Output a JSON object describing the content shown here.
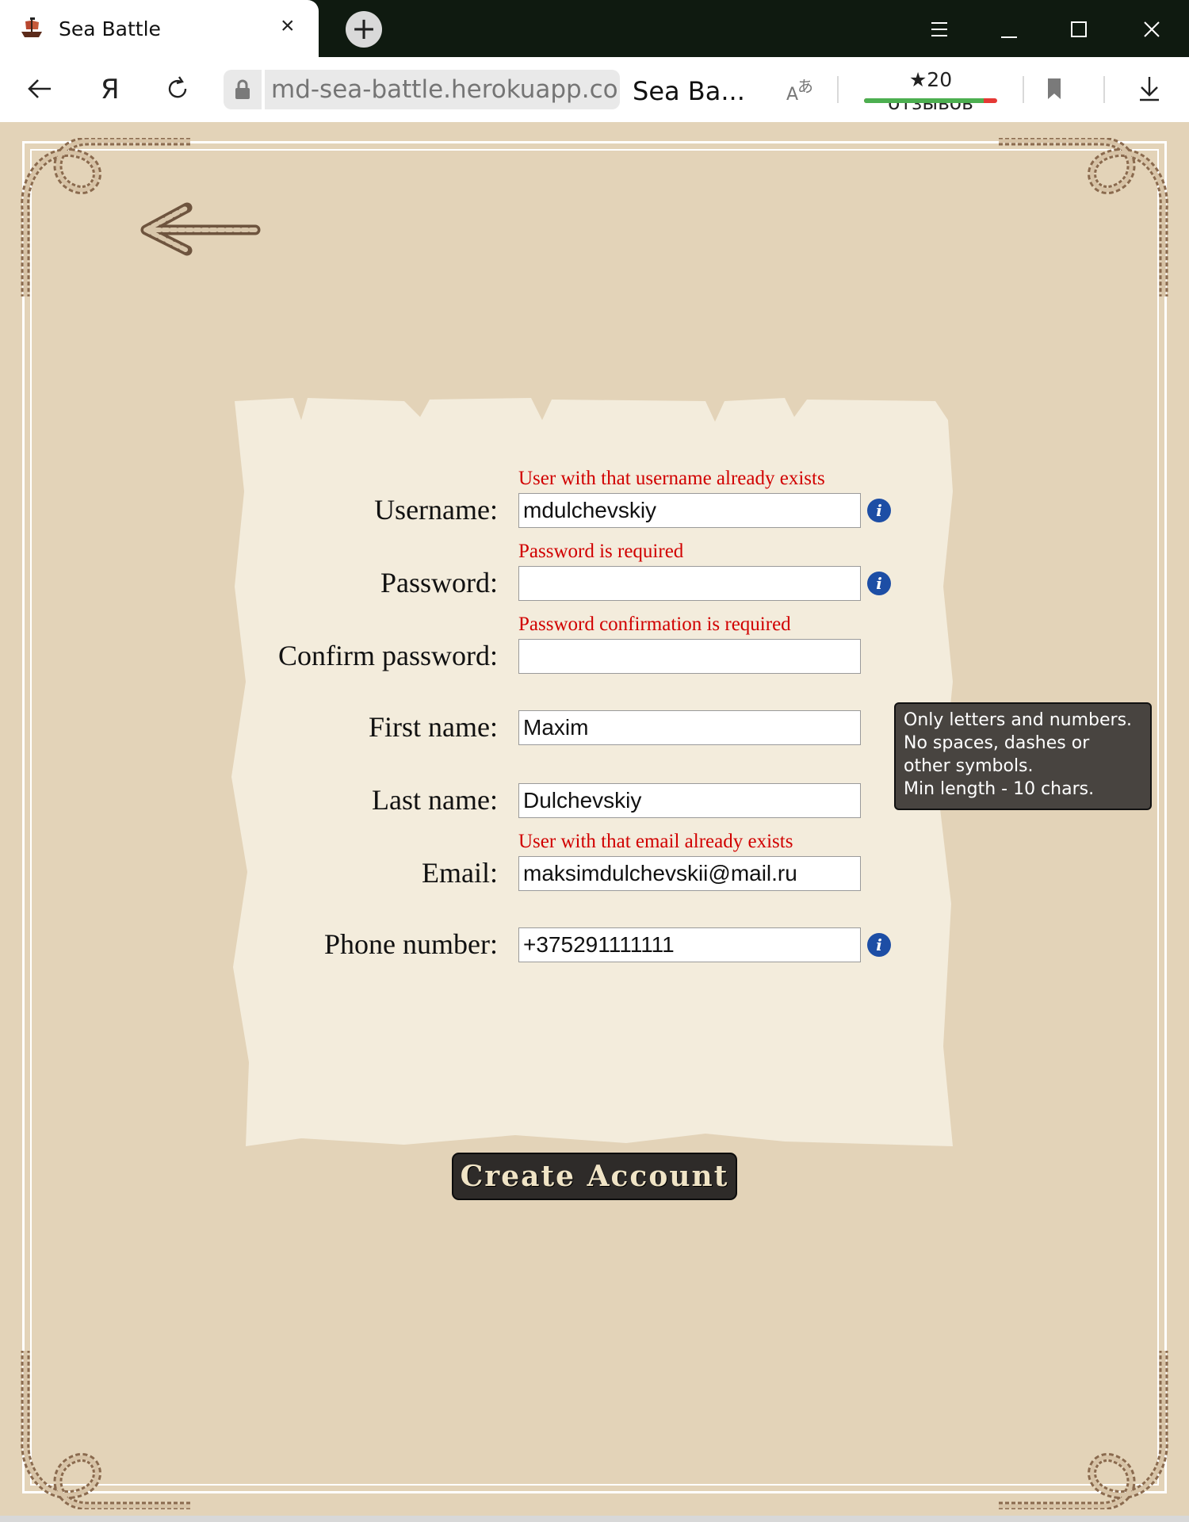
{
  "browser": {
    "tab_title": "Sea Battle",
    "tab_close": "×",
    "new_tab": "+",
    "url": "md-sea-battle.herokuapp.com",
    "page_title": "Sea Ba...",
    "reviews_label": "★20 отзывов",
    "reviews_positive_fraction": 0.9
  },
  "form": {
    "username": {
      "label": "Username:",
      "value": "mdulchevskiy",
      "error": "User with that username already exists"
    },
    "password": {
      "label": "Password:",
      "value": "",
      "error": "Password is required"
    },
    "confirm_password": {
      "label": "Confirm password:",
      "value": "",
      "error": "Password confirmation is required"
    },
    "first_name": {
      "label": "First name:",
      "value": "Maxim"
    },
    "last_name": {
      "label": "Last name:",
      "value": "Dulchevskiy"
    },
    "email": {
      "label": "Email:",
      "value": "maksimdulchevskii@mail.ru",
      "error": "User with that email already exists"
    },
    "phone": {
      "label": "Phone number:",
      "value": "+375291111111"
    },
    "info_glyph": "i",
    "submit_label": "Create Account"
  },
  "tooltip": {
    "line1": "Only letters and numbers.",
    "line2": "No spaces, dashes or",
    "line3": "other symbols.",
    "line4": "Min length - 10 chars."
  },
  "colors": {
    "page_bg": "#e3d3b8",
    "paper": "#f3ecdc",
    "error": "#d10000",
    "info": "#1d4ea5",
    "button": "#2e2b29",
    "rope": "#c9b49a"
  }
}
